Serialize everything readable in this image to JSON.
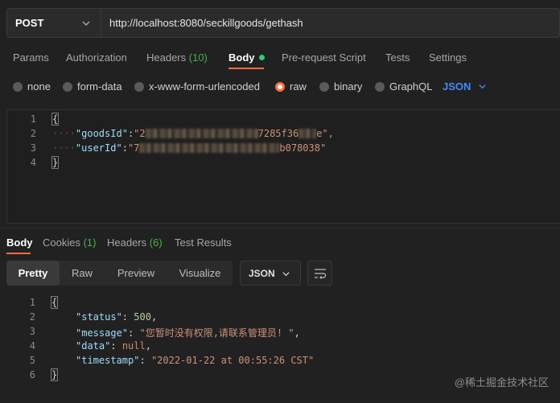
{
  "request": {
    "method": "POST",
    "url": "http://localhost:8080/seckillgoods/gethash"
  },
  "request_tabs": [
    {
      "label": "Params"
    },
    {
      "label": "Authorization"
    },
    {
      "label": "Headers",
      "count": "(10)"
    },
    {
      "label": "Body"
    },
    {
      "label": "Pre-request Script"
    },
    {
      "label": "Tests"
    },
    {
      "label": "Settings"
    }
  ],
  "body_types": {
    "options": [
      "none",
      "form-data",
      "x-www-form-urlencoded",
      "raw",
      "binary",
      "GraphQL"
    ],
    "selected": "raw",
    "format": "JSON"
  },
  "request_body": {
    "line_numbers": [
      "1",
      "2",
      "3",
      "4"
    ],
    "open": "{",
    "close": "}",
    "goods_key": "\"goodsId\"",
    "goods_value_start": "\"2",
    "goods_value_mid": "7285f36",
    "goods_value_end": "e\",",
    "user_key": "\"userId\"",
    "user_value_start": "\"7",
    "user_value_end": "b078038\""
  },
  "response_tabs": [
    {
      "label": "Body"
    },
    {
      "label": "Cookies",
      "count": "(1)"
    },
    {
      "label": "Headers",
      "count": "(6)"
    },
    {
      "label": "Test Results"
    }
  ],
  "view_modes": [
    "Pretty",
    "Raw",
    "Preview",
    "Visualize"
  ],
  "response_format": "JSON",
  "response_body": {
    "line_numbers": [
      "1",
      "2",
      "3",
      "4",
      "5",
      "6"
    ],
    "open": "{",
    "close": "}",
    "status_key": "\"status\"",
    "status_value": "500",
    "message_key": "\"message\"",
    "message_value": "\"您暂时没有权限,请联系管理员! \"",
    "data_key": "\"data\"",
    "data_value": "null",
    "timestamp_key": "\"timestamp\"",
    "timestamp_value": "\"2022-01-22 at 00:55:26 CST\""
  },
  "watermark": "@稀土掘金技术社区",
  "colors": {
    "accent": "#ff6c37",
    "link_blue": "#3d8bfd",
    "count_green": "#4cae4c"
  }
}
